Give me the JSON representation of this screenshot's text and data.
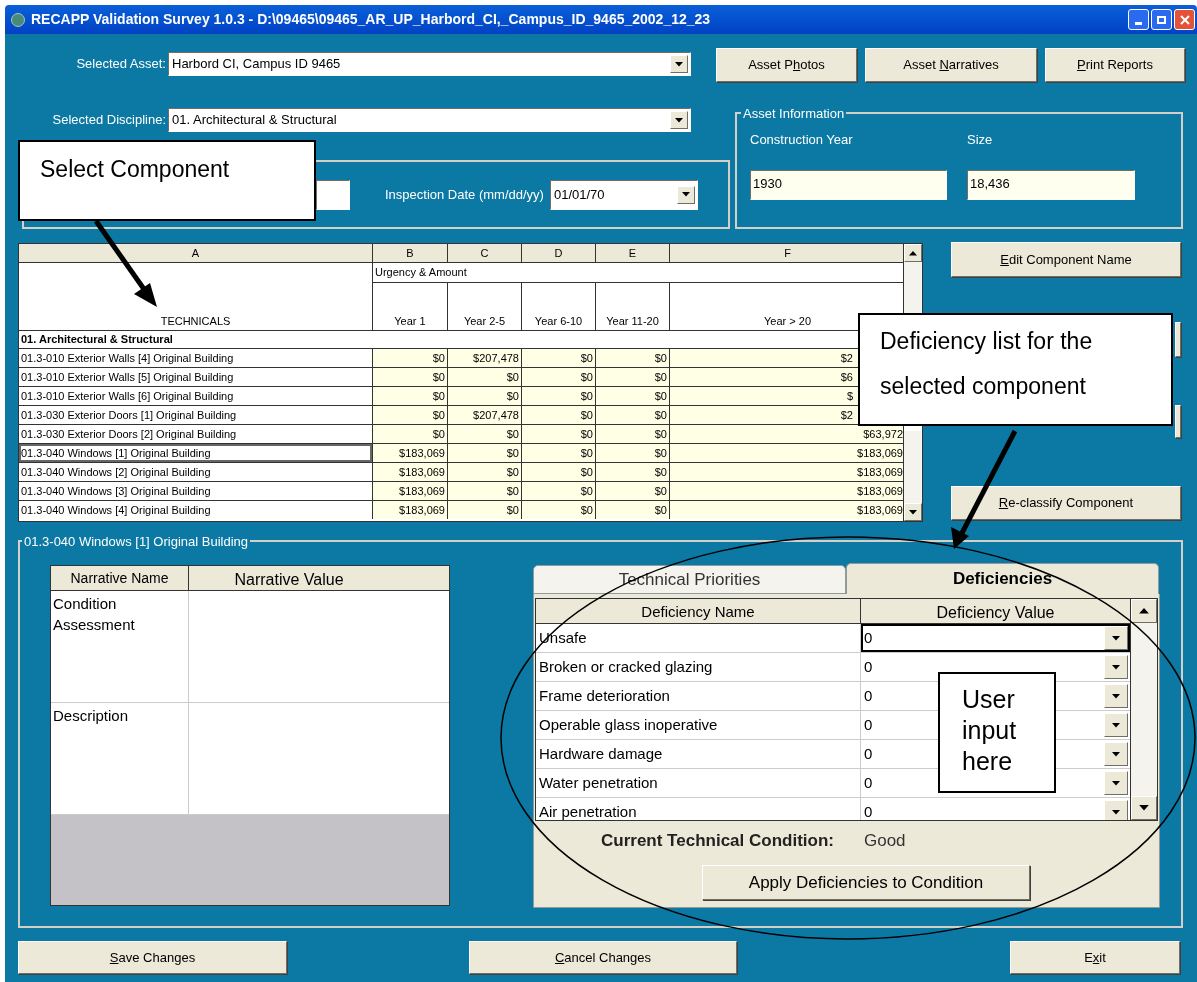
{
  "window": {
    "title": "RECAPP Validation Survey 1.0.3 - D:\\09465\\09465_AR_UP_Harbord_CI,_Campus_ID_9465_2002_12_23"
  },
  "selected_asset": {
    "label": "Selected Asset:",
    "value": "Harbord CI, Campus ID 9465"
  },
  "selected_discipline": {
    "label": "Selected Discipline:",
    "value": "01. Architectural & Structural"
  },
  "top_buttons": [
    {
      "before": "Asset P",
      "key": "h",
      "after": "otos"
    },
    {
      "before": "Asset ",
      "key": "N",
      "after": "arratives"
    },
    {
      "key": "P",
      "after": "rint Reports"
    }
  ],
  "inspection_date": {
    "label": "Inspection Date (mm/dd/yy)",
    "value": "01/01/70"
  },
  "asset_information": {
    "title": "Asset Information",
    "fields": [
      {
        "label": "Construction Year",
        "value": "1930"
      },
      {
        "label": "Size",
        "value": "18,436"
      }
    ]
  },
  "grid": {
    "column_letters": [
      "A",
      "B",
      "C",
      "D",
      "E",
      "F"
    ],
    "group_header": "Urgency & Amount",
    "name_header": "TECHNICALS",
    "year_headers": [
      "Year 1",
      "Year 2-5",
      "Year 6-10",
      "Year 11-20",
      "Year > 20"
    ],
    "section": "01. Architectural & Structural",
    "rows": [
      {
        "name": "01.3-010 Exterior Walls [4] Original Building",
        "values": [
          "$0",
          "$207,478",
          "$0",
          "$0",
          "$2"
        ],
        "cut": true,
        "selected": false
      },
      {
        "name": "01.3-010 Exterior Walls [5] Original Building",
        "values": [
          "$0",
          "$0",
          "$0",
          "$0",
          "$6"
        ],
        "cut": true,
        "selected": false
      },
      {
        "name": "01.3-010 Exterior Walls [6] Original Building",
        "values": [
          "$0",
          "$0",
          "$0",
          "$0",
          "$"
        ],
        "cut": true,
        "selected": false
      },
      {
        "name": "01.3-030 Exterior Doors [1] Original Building",
        "values": [
          "$0",
          "$207,478",
          "$0",
          "$0",
          "$2"
        ],
        "cut": true,
        "selected": false
      },
      {
        "name": "01.3-030 Exterior Doors [2] Original Building",
        "values": [
          "$0",
          "$0",
          "$0",
          "$0",
          "$63,972"
        ],
        "cut": false,
        "selected": false
      },
      {
        "name": "01.3-040 Windows [1] Original Building",
        "values": [
          "$183,069",
          "$0",
          "$0",
          "$0",
          "$183,069"
        ],
        "cut": false,
        "selected": true
      },
      {
        "name": "01.3-040 Windows [2] Original Building",
        "values": [
          "$183,069",
          "$0",
          "$0",
          "$0",
          "$183,069"
        ],
        "cut": false,
        "selected": false
      },
      {
        "name": "01.3-040 Windows [3] Original Building",
        "values": [
          "$183,069",
          "$0",
          "$0",
          "$0",
          "$183,069"
        ],
        "cut": false,
        "selected": false
      },
      {
        "name": "01.3-040 Windows [4] Original Building",
        "values": [
          "$183,069",
          "$0",
          "$0",
          "$0",
          "$183,069"
        ],
        "cut": false,
        "selected": false
      }
    ]
  },
  "side_buttons": [
    {
      "key": "E",
      "after": "dit Component Name"
    },
    {
      "key": "R",
      "after": "e-classify Component"
    }
  ],
  "component_panel": {
    "title": "01.3-040 Windows [1] Original Building"
  },
  "narratives": {
    "columns": [
      "Narrative Name",
      "Narrative Value"
    ],
    "rows": [
      {
        "name": "Condition Assessment"
      },
      {
        "name": "Description"
      }
    ]
  },
  "tabs": [
    {
      "label": "Technical Priorities",
      "selected": false
    },
    {
      "label": "Deficiencies",
      "selected": true
    }
  ],
  "deficiencies": {
    "columns": [
      "Deficiency Name",
      "Deficiency Value"
    ],
    "rows": [
      {
        "name": "Unsafe",
        "value": "0",
        "focused": true
      },
      {
        "name": "Broken or cracked glazing",
        "value": "0",
        "focused": false
      },
      {
        "name": "Frame deterioration",
        "value": "0",
        "focused": false
      },
      {
        "name": "Operable glass inoperative",
        "value": "0",
        "focused": false
      },
      {
        "name": "Hardware damage",
        "value": "0",
        "focused": false
      },
      {
        "name": "Water penetration",
        "value": "0",
        "focused": false
      },
      {
        "name": "Air penetration",
        "value": "0",
        "focused": false
      }
    ]
  },
  "condition": {
    "label": "Current Technical Condition:",
    "value": "Good"
  },
  "apply_button": "Apply Deficiencies to Condition",
  "bottom_buttons": [
    {
      "key": "S",
      "after": "ave Changes"
    },
    {
      "key": "C",
      "after": "ancel Changes"
    },
    {
      "before": "E",
      "key": "x",
      "after": "it"
    }
  ],
  "annotations": [
    {
      "text": "Select Component"
    },
    {
      "text": "Deficiency list for the selected component"
    },
    {
      "text": "User input here"
    }
  ]
}
